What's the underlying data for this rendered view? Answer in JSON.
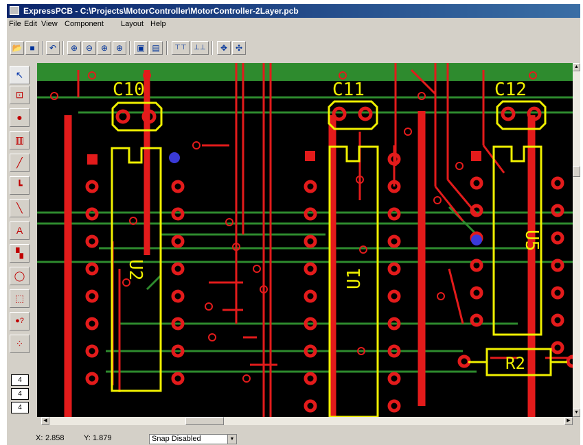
{
  "window": {
    "title": "ExpressPCB - C:\\Projects\\MotorController\\MotorController-2Layer.pcb"
  },
  "menu": [
    "File",
    "Edit",
    "View",
    "Component",
    "Layout",
    "Help"
  ],
  "toolbar": [
    {
      "icon": "open-folder-icon",
      "glyph": "📂"
    },
    {
      "icon": "save-icon",
      "glyph": "■"
    },
    {
      "icon": "undo-icon",
      "glyph": "↶"
    },
    {
      "icon": "zoom-in-icon",
      "glyph": "⊕"
    },
    {
      "icon": "zoom-out-icon",
      "glyph": "⊖"
    },
    {
      "icon": "zoom-window-icon",
      "glyph": "⊕"
    },
    {
      "icon": "zoom-fit-icon",
      "glyph": "⊕"
    },
    {
      "icon": "component-properties-icon",
      "glyph": "▣"
    },
    {
      "icon": "component-edit-icon",
      "glyph": "▤"
    },
    {
      "icon": "top-layer-icon",
      "glyph": "⊤⊤"
    },
    {
      "icon": "bottom-layer-icon",
      "glyph": "⊥⊥"
    },
    {
      "icon": "move-icon",
      "glyph": "✥"
    },
    {
      "icon": "pan-icon",
      "glyph": "✣"
    }
  ],
  "tools": [
    {
      "icon": "pointer-tool-icon",
      "glyph": "↖"
    },
    {
      "icon": "zoom-tool-icon",
      "glyph": "⊡"
    },
    {
      "icon": "pad-tool-icon",
      "glyph": "●"
    },
    {
      "icon": "component-tool-icon",
      "glyph": "▥"
    },
    {
      "icon": "trace-tool-icon",
      "glyph": "╱"
    },
    {
      "icon": "angle-trace-tool-icon",
      "glyph": "┗"
    },
    {
      "icon": "diagonal-trace-tool-icon",
      "glyph": "╲"
    },
    {
      "icon": "text-tool-icon",
      "glyph": "A"
    },
    {
      "icon": "filled-rect-tool-icon",
      "glyph": "▚"
    },
    {
      "icon": "circle-tool-icon",
      "glyph": "◯"
    },
    {
      "icon": "rectangle-tool-icon",
      "glyph": "⬚"
    },
    {
      "icon": "query-pad-tool-icon",
      "glyph": "●?"
    },
    {
      "icon": "netlist-tool-icon",
      "glyph": "⁘"
    }
  ],
  "layers": [
    {
      "label": "4"
    },
    {
      "label": "4"
    },
    {
      "label": "4"
    }
  ],
  "components": {
    "c10": "C10",
    "c11": "C11",
    "c12": "C12",
    "u1": "U1",
    "u2": "U2",
    "u5": "U5",
    "r2": "R2"
  },
  "status": {
    "x_label": "X:",
    "x_value": "2.858",
    "y_label": "Y:",
    "y_value": "1.879",
    "snap_label": "Snap",
    "snap_value": "Disabled"
  },
  "colors": {
    "board_background": "#000000",
    "trace_top": "#e31b1b",
    "trace_bottom": "#2e8b2e",
    "silkscreen": "#f0f000",
    "via": "#3a3ad8"
  }
}
